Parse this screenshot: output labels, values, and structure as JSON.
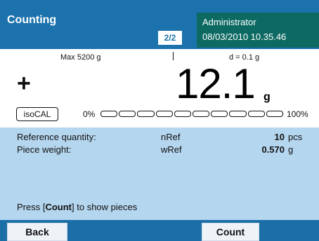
{
  "header": {
    "title": "Counting",
    "page_indicator": "2/2",
    "user": "Administrator",
    "datetime": "08/03/2010 10.35.46"
  },
  "weighing": {
    "max_info": "Max 5200 g",
    "d_info": "d = 0.1 g",
    "sign": "+",
    "value": "12.1",
    "unit": "g",
    "isocal_label": "isoCAL",
    "range_min_label": "0%",
    "range_max_label": "100%",
    "range_fill": 0.0
  },
  "info": {
    "rows": [
      {
        "label": "Reference quantity:",
        "symbol": "nRef",
        "value": "10",
        "unit": "pcs"
      },
      {
        "label": "Piece weight:",
        "symbol": "wRef",
        "value": "0.570",
        "unit": "g"
      }
    ],
    "hint_prefix": "Press [",
    "hint_key": "Count",
    "hint_suffix": "] to show pieces"
  },
  "footer": {
    "back_label": "Back",
    "count_label": "Count"
  },
  "colors": {
    "header_blue": "#1b72ad",
    "user_box_teal": "#0d6a63",
    "info_panel": "#b5d6ef"
  }
}
